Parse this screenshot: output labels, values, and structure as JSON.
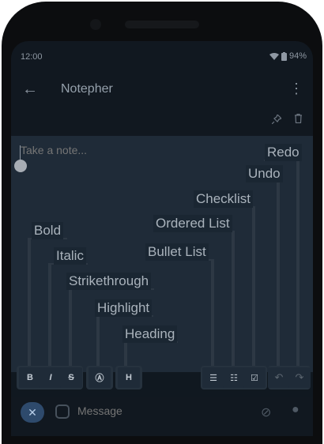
{
  "status": {
    "time": "12:00",
    "battery": "94%"
  },
  "appbar": {
    "title": "Notepher"
  },
  "note": {
    "placeholder": "Take a note..."
  },
  "callouts": {
    "redo": "Redo",
    "undo": "Undo",
    "checklist": "Checklist",
    "ordered_list": "Ordered List",
    "bullet_list": "Bullet List",
    "bold": "Bold",
    "italic": "Italic",
    "strikethrough": "Strikethrough",
    "highlight": "Highlight",
    "heading": "Heading"
  },
  "toolbar": {
    "bold": "B",
    "italic": "I",
    "strike": "S",
    "highlight": "Ⓐ",
    "heading": "H",
    "bullet": "☰",
    "ordered": "☷",
    "checklist": "☑",
    "undo": "↶",
    "redo": "↷"
  },
  "message": {
    "placeholder": "Message"
  },
  "colors": {
    "surface": "#1f2b38",
    "accent": "#2e4a6c"
  }
}
